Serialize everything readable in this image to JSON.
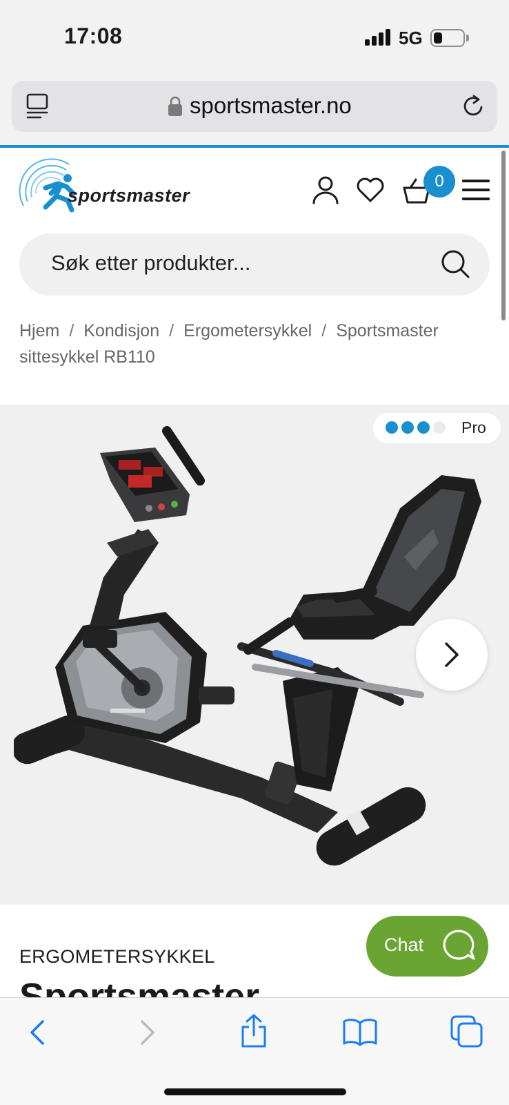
{
  "status_bar": {
    "time": "17:08",
    "network": "5G",
    "signal_bars": 4,
    "battery_level": 0.2,
    "icons": [
      "signal-icon",
      "battery-icon"
    ]
  },
  "browser": {
    "url": "sportsmaster.no",
    "icons": [
      "reader-icon",
      "lock-icon",
      "reload-icon"
    ],
    "progress_color": "#1a8fd0"
  },
  "header": {
    "logo_text": "sportsmaster",
    "cart_count": "0",
    "icons": [
      "account-icon",
      "heart-icon",
      "cart-icon",
      "menu-icon"
    ],
    "brand_color": "#1a8fd0"
  },
  "search": {
    "placeholder": "Søk etter produkter...",
    "icon": "search-icon"
  },
  "breadcrumb": {
    "items": [
      "Hjem",
      "Kondisjon",
      "Ergometersykkel",
      "Sportsmaster sittesykkel RB110"
    ],
    "separator": "/"
  },
  "gallery": {
    "level_label": "Pro",
    "level_filled": 3,
    "level_total": 4,
    "dot_color": "#1a8fd0",
    "dot_empty_color": "#ebebeb",
    "image": "recumbent-bike-image",
    "next_icon": "chevron-right-icon"
  },
  "product": {
    "category": "ERGOMETERSYKKEL",
    "title": "Sportsmaster"
  },
  "chat": {
    "label": "Chat",
    "color": "#6aa534",
    "icon": "chat-bubble-icon"
  },
  "toolbar": {
    "icons": [
      "back-icon",
      "forward-icon",
      "share-icon",
      "bookmarks-icon",
      "tabs-icon"
    ],
    "accent": "#1a7df0"
  }
}
